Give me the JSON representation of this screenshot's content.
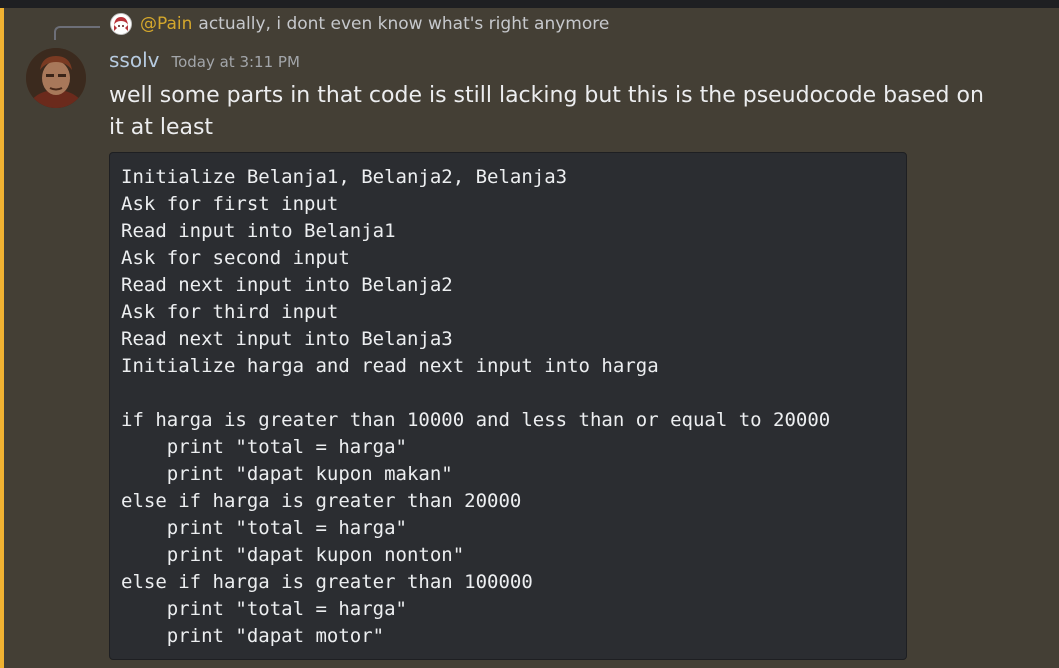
{
  "reply": {
    "mention": "@Pain",
    "text": "actually, i dont even know what's right anymore",
    "avatar": "anime-avatar-icon"
  },
  "message": {
    "username": "ssolv",
    "timestamp": "Today at 3:11 PM",
    "text": "well some parts in that code is still lacking but this is the pseudocode based on it at least",
    "avatar": "user-avatar-icon"
  },
  "code": {
    "lines": [
      "Initialize Belanja1, Belanja2, Belanja3",
      "Ask for first input",
      "Read input into Belanja1",
      "Ask for second input",
      "Read next input into Belanja2",
      "Ask for third input",
      "Read next input into Belanja3",
      "Initialize harga and read next input into harga",
      "",
      "if harga is greater than 10000 and less than or equal to 20000",
      "    print \"total = harga\"",
      "    print \"dapat kupon makan\"",
      "else if harga is greater than 20000",
      "    print \"total = harga\"",
      "    print \"dapat kupon nonton\"",
      "else if harga is greater than 100000",
      "    print \"total = harga\"",
      "    print \"dapat motor\""
    ]
  },
  "colors": {
    "mention_highlight_bg": "#443f35",
    "mention_bar": "#f0b232",
    "username": "#b7cbe0",
    "mention_text": "#d4a72c",
    "code_bg": "#2b2d31"
  }
}
